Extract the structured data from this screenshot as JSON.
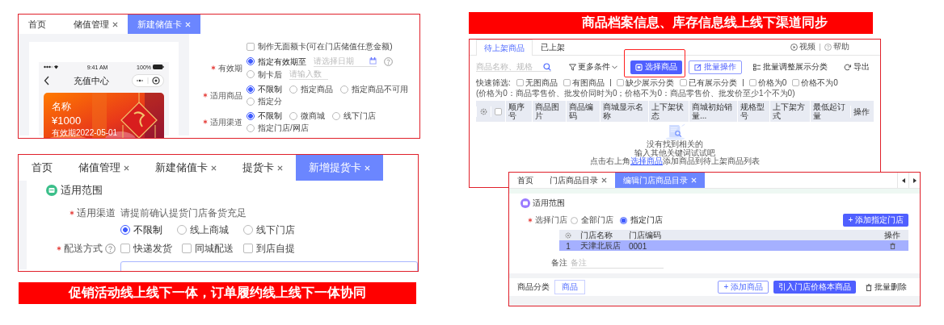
{
  "captions": [
    {
      "text": "商品档案信息、库存信息线上线下渠道同步"
    },
    {
      "text": "促销活动线上线下一体，订单履约线上线下一体协同"
    }
  ],
  "stored_value_card_window": {
    "tabs": [
      {
        "label": "首页",
        "closable": false,
        "selected": false
      },
      {
        "label": "储值管理",
        "closable": true,
        "selected": false
      },
      {
        "label": "新建储值卡",
        "closable": true,
        "selected": true
      }
    ],
    "phone_preview": {
      "status_time": "9:41 AM",
      "battery": "100%",
      "title": "充值中心",
      "card": {
        "name": "名称",
        "amount": "¥1000",
        "validity": "有效期2022-05-01"
      }
    },
    "form": [
      {
        "kind": "checkbox",
        "label": "制作无面额卡(可在门店储值任意金额)",
        "checked": false
      },
      {
        "kind": "radios",
        "label": "有效期",
        "required": true,
        "options": [
          {
            "label": "指定有效期至",
            "selected": true,
            "kind": "date",
            "placeholder": "请选择日期"
          },
          {
            "label": "制卡后",
            "selected": false,
            "kind": "text",
            "placeholder": "请输入数"
          }
        ]
      },
      {
        "kind": "radios",
        "label": "适用商品",
        "required": true,
        "options": [
          {
            "label": "不限制",
            "selected": true
          },
          {
            "label": "指定商品",
            "selected": false
          },
          {
            "label": "指定商品不可用",
            "selected": false
          },
          {
            "label": "指定分",
            "selected": false
          }
        ]
      },
      {
        "kind": "radios",
        "label": "适用渠道",
        "required": true,
        "options": [
          {
            "label": "不限制",
            "selected": true
          },
          {
            "label": "微商城",
            "selected": false
          },
          {
            "label": "线下门店",
            "selected": false
          },
          {
            "label": "指定门店/网店",
            "selected": false
          }
        ]
      }
    ]
  },
  "pickup_card_window": {
    "tabs": [
      {
        "label": "首页",
        "closable": false,
        "selected": false
      },
      {
        "label": "储值管理",
        "closable": true,
        "selected": false
      },
      {
        "label": "新建储值卡",
        "closable": true,
        "selected": false
      },
      {
        "label": "提货卡",
        "closable": true,
        "selected": false
      },
      {
        "label": "新增提货卡",
        "closable": true,
        "selected": true
      }
    ],
    "section": {
      "title": "适用范围"
    },
    "form": [
      {
        "kind": "radios",
        "label": "适用渠道",
        "required": true,
        "hint": "请提前确认提货门店备货充足",
        "options": [
          {
            "label": "不限制",
            "selected": true
          },
          {
            "label": "线上商城",
            "selected": false
          },
          {
            "label": "线下门店",
            "selected": false
          }
        ]
      },
      {
        "kind": "checkboxes",
        "label": "配送方式",
        "required": true,
        "help": true,
        "options": [
          {
            "label": "快递发货",
            "checked": false
          },
          {
            "label": "同城配送",
            "checked": false
          },
          {
            "label": "到店自提",
            "checked": false
          }
        ]
      }
    ]
  },
  "product_listing_window": {
    "tabs": [
      {
        "label": "待上架商品",
        "selected": true
      },
      {
        "label": "已上架",
        "selected": false
      }
    ],
    "help_links": [
      {
        "label": "视频",
        "kind": "video"
      },
      {
        "label": "帮助",
        "kind": "help"
      }
    ],
    "search": {
      "placeholder": "商品名称、规格"
    },
    "more_filters": {
      "label": "更多条件"
    },
    "actions": [
      {
        "label": "选择商品",
        "kind": "primary",
        "highlighted": true
      },
      {
        "label": "批量操作",
        "kind": "outline",
        "highlighted": false
      },
      {
        "label": "批量调整展示分类",
        "kind": "list",
        "highlighted": false
      },
      {
        "label": "导出",
        "kind": "export",
        "highlighted": false
      }
    ],
    "quick_filter": {
      "label": "快速筛选:",
      "groups": [
        {
          "options": [
            {
              "label": "无图商品",
              "checked": false
            },
            {
              "label": "有图商品",
              "checked": false
            }
          ]
        },
        {
          "options": [
            {
              "label": "缺少展示分类",
              "checked": false
            },
            {
              "label": "已有展示分类",
              "checked": false
            }
          ]
        },
        {
          "options": [
            {
              "label": "价格为0",
              "checked": false
            },
            {
              "label": "价格不为0",
              "checked": false
            }
          ]
        }
      ],
      "note": "(价格为0：商品零售价、批发价同时为0；价格不为0：商品零售价、批发价至少1个不为0)"
    },
    "table": {
      "select_all": {
        "checked": false
      },
      "columns": [
        "顺序号",
        "商品图片",
        "商品编码",
        "商城显示名称",
        "上下架状态",
        "商城初始销量...",
        "规格型号",
        "上下架方式",
        "最低起订量",
        "操作"
      ],
      "empty_state": {
        "messages": [
          "没有找到相关的",
          "输入其他关键词试试吧"
        ],
        "hint": {
          "before": "点击右上角",
          "link": "选择商品",
          "after": "添加商品到待上架商品列表"
        }
      }
    }
  },
  "store_catalog_window": {
    "tabs": [
      {
        "label": "首页",
        "closable": false,
        "selected": false
      },
      {
        "label": "门店商品目录",
        "closable": true,
        "selected": false
      },
      {
        "label": "编辑门店商品目录",
        "closable": true,
        "selected": true
      }
    ],
    "section": {
      "title": "适用范围"
    },
    "store_choice": {
      "label": "选择门店",
      "required": true,
      "options": [
        {
          "label": "全部门店",
          "selected": false
        },
        {
          "label": "指定门店",
          "selected": true
        }
      ]
    },
    "add_store_button": "+ 添加指定门店",
    "table": {
      "columns": [
        "门店名称",
        "门店编码",
        "操作"
      ],
      "rows": [
        {
          "index": "1",
          "name": "天津北辰店",
          "code": "0001",
          "selected": true
        }
      ]
    },
    "remark": {
      "label": "备注",
      "placeholder": "备注"
    },
    "bottom": {
      "label": "商品分类",
      "tabs": [
        {
          "label": "商品",
          "selected": true
        }
      ],
      "buttons": [
        {
          "label": "+ 添加商品",
          "kind": "outline"
        },
        {
          "label": "引入门店价格本商品",
          "kind": "primary"
        },
        {
          "label": "批量删除",
          "kind": "text"
        }
      ]
    }
  }
}
